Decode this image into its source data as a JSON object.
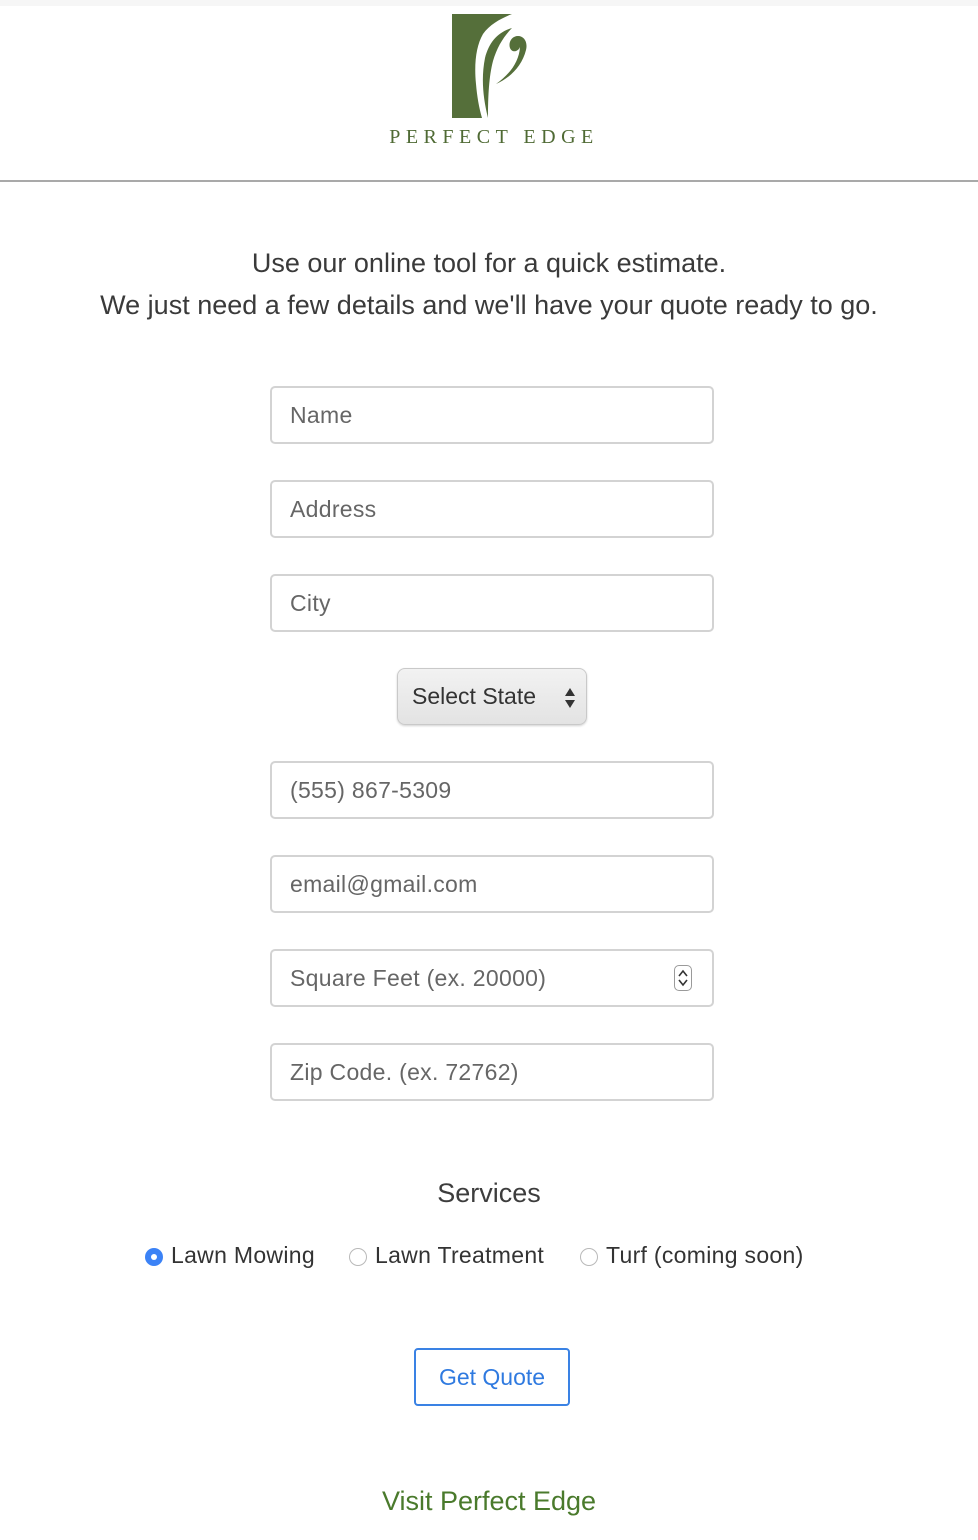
{
  "brand": {
    "name": "PERFECT EDGE",
    "logo_color": "#4f6a34"
  },
  "intro": {
    "line1": "Use our online tool for a quick estimate.",
    "line2": "We just need a few details and we'll have your quote ready to go."
  },
  "form": {
    "name": {
      "placeholder": "Name",
      "value": ""
    },
    "address": {
      "placeholder": "Address",
      "value": ""
    },
    "city": {
      "placeholder": "City",
      "value": ""
    },
    "state": {
      "selected": "Select State"
    },
    "phone": {
      "placeholder": "(555) 867-5309",
      "value": ""
    },
    "email": {
      "placeholder": "email@gmail.com",
      "value": ""
    },
    "square_feet": {
      "placeholder": "Square Feet (ex. 20000)",
      "value": ""
    },
    "zip": {
      "placeholder": "Zip Code. (ex. 72762)",
      "value": ""
    }
  },
  "services": {
    "title": "Services",
    "options": [
      {
        "label": "Lawn Mowing",
        "checked": true
      },
      {
        "label": "Lawn Treatment",
        "checked": false
      },
      {
        "label": "Turf (coming soon)",
        "checked": false
      }
    ]
  },
  "actions": {
    "get_quote_label": "Get Quote",
    "visit_link_label": "Visit Perfect Edge"
  },
  "colors": {
    "accent_blue": "#3a82e4",
    "link_green": "#4a7a2c",
    "border_gray": "#d3d3d3"
  }
}
